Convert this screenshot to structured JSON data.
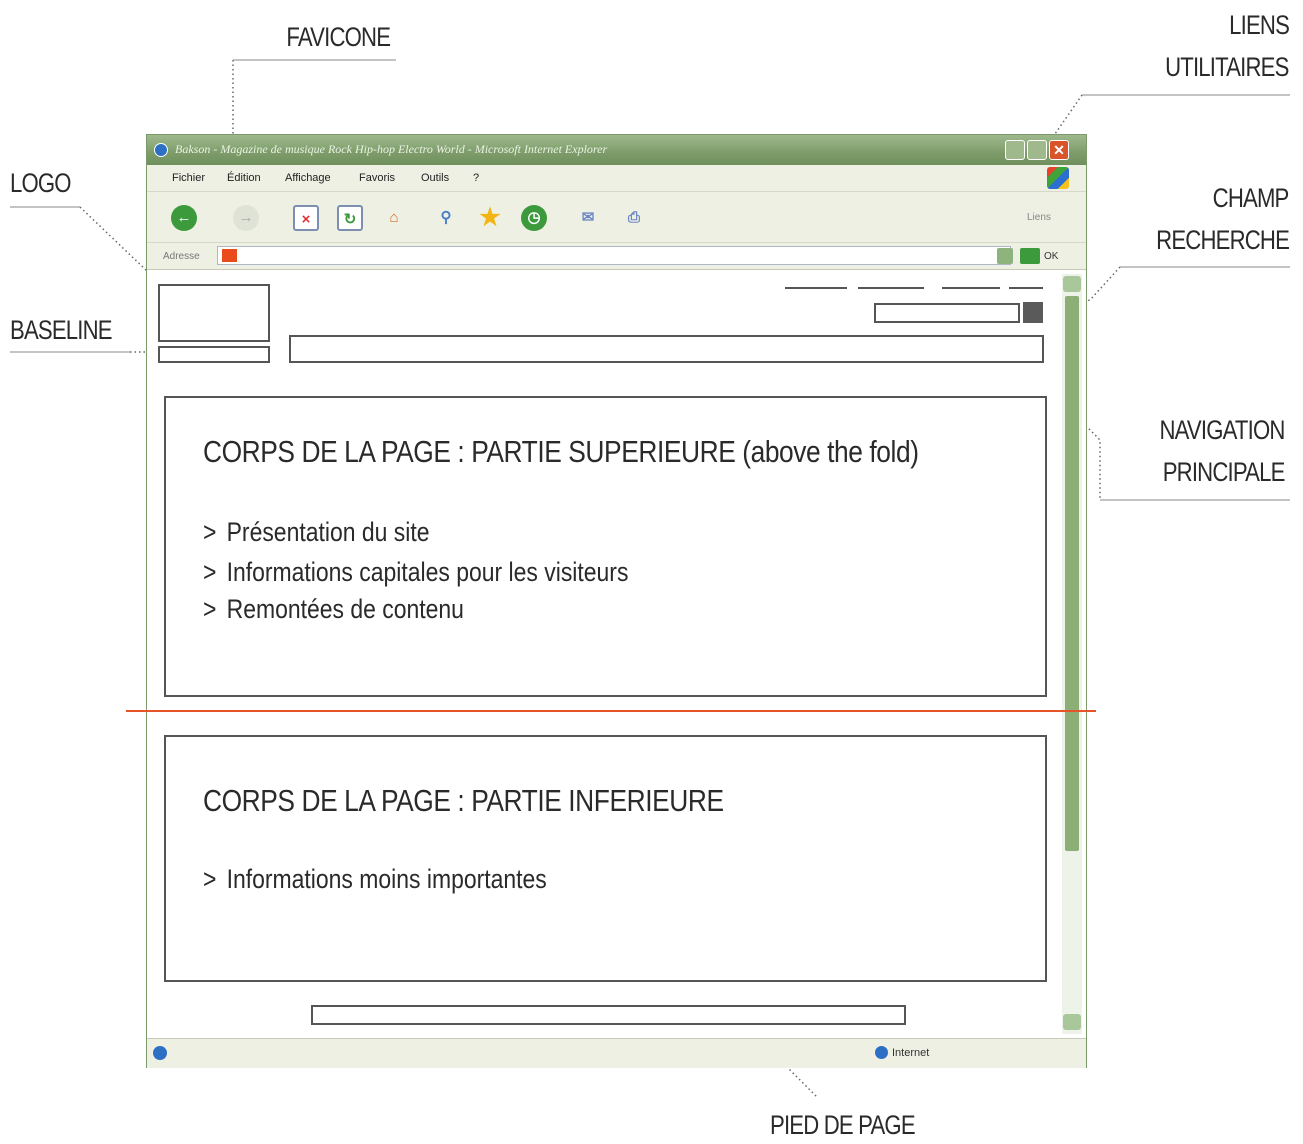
{
  "callouts": {
    "favicone": "FAVICONE",
    "logo": "LOGO",
    "baseline": "BASELINE",
    "liens_line1": "LIENS",
    "liens_line2": "UTILITAIRES",
    "champ_line1": "CHAMP",
    "champ_line2": "RECHERCHE",
    "nav_line1": "NAVIGATION",
    "nav_line2": "PRINCIPALE",
    "pied": "PIED DE PAGE"
  },
  "browser": {
    "title": "Bakson - Magazine de musique Rock Hip-hop Electro World - Microsoft Internet Explorer",
    "menu": [
      "Fichier",
      "Édition",
      "Affichage",
      "Favoris",
      "Outils",
      "?"
    ],
    "liens": "Liens",
    "address_label": "Adresse",
    "ok": "OK",
    "status": "Internet"
  },
  "upper": {
    "title": "CORPS DE LA PAGE : PARTIE SUPERIEURE (above the fold)",
    "items": [
      "Présentation du site",
      "Informations capitales pour les visiteurs",
      "Remontées de contenu"
    ]
  },
  "lower": {
    "title": "CORPS DE LA PAGE : PARTIE INFERIEURE",
    "items": [
      "Informations moins importantes"
    ]
  },
  "bullet_marker": ">",
  "colors": {
    "fold_line": "#e8542a",
    "favicon": "#e94b1c",
    "window_chrome": "#7d9c6a",
    "scroll_thumb": "#8caf78"
  }
}
